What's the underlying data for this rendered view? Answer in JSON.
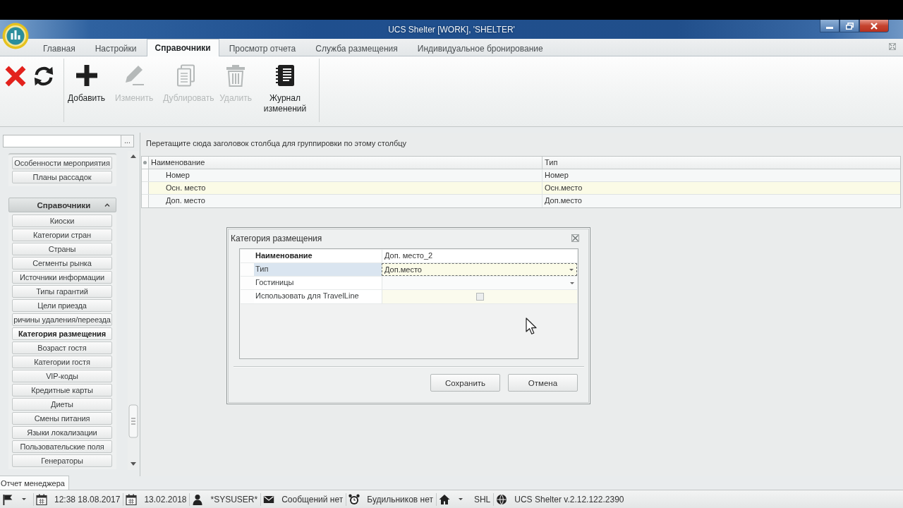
{
  "window": {
    "title": "UCS Shelter [WORK], 'SHELTER'"
  },
  "ribbon_tabs": [
    {
      "label": "Главная",
      "selected": false
    },
    {
      "label": "Настройки",
      "selected": false
    },
    {
      "label": "Справочники",
      "selected": true
    },
    {
      "label": "Просмотр отчета",
      "selected": false
    },
    {
      "label": "Служба размещения",
      "selected": false
    },
    {
      "label": "Индивидуальное бронирование",
      "selected": false
    }
  ],
  "ribbon_groups": [
    {
      "buttons": [
        {
          "kind": "cancel",
          "disabled": false
        },
        {
          "kind": "refresh",
          "disabled": false
        }
      ]
    },
    {
      "buttons": [
        {
          "kind": "add",
          "label": "Добавить",
          "disabled": false
        },
        {
          "kind": "edit",
          "label": "Изменить",
          "disabled": true
        },
        {
          "kind": "duplicate",
          "label": "Дублировать",
          "disabled": true
        },
        {
          "kind": "delete",
          "label": "Удалить",
          "disabled": true
        },
        {
          "kind": "journal",
          "label": "Журнал изменений",
          "disabled": false
        }
      ]
    }
  ],
  "sidebar": {
    "search_button": "...",
    "groups": [
      {
        "items": [
          {
            "label": "Особенности мероприятия",
            "selected": false
          },
          {
            "label": "Планы рассадок",
            "selected": false
          }
        ]
      },
      {
        "title": "Справочники",
        "expanded": true,
        "items": [
          {
            "label": "Киоски",
            "selected": false
          },
          {
            "label": "Категории стран",
            "selected": false
          },
          {
            "label": "Страны",
            "selected": false
          },
          {
            "label": "Сегменты рынка",
            "selected": false
          },
          {
            "label": "Источники информации",
            "selected": false
          },
          {
            "label": "Типы гарантий",
            "selected": false
          },
          {
            "label": "Цели приезда",
            "selected": false
          },
          {
            "label": "ричины удаления/переезда",
            "selected": false
          },
          {
            "label": "Категория размещения",
            "selected": true
          },
          {
            "label": "Возраст гостя",
            "selected": false
          },
          {
            "label": "Категории гостя",
            "selected": false
          },
          {
            "label": "VIP-коды",
            "selected": false
          },
          {
            "label": "Кредитные карты",
            "selected": false
          },
          {
            "label": "Диеты",
            "selected": false
          },
          {
            "label": "Смены питания",
            "selected": false
          },
          {
            "label": "Языки локализации",
            "selected": false
          },
          {
            "label": "Пользовательские поля",
            "selected": false
          },
          {
            "label": "Генераторы",
            "selected": false
          }
        ]
      }
    ]
  },
  "main": {
    "group_panel_hint": "Перетащите сюда заголовок столбца для группировки по этому столбцу",
    "grid": {
      "columns": [
        "Наименование",
        "Тип"
      ],
      "rows": [
        {
          "cells": [
            "Номер",
            "Номер"
          ],
          "selected": false
        },
        {
          "cells": [
            "Осн. место",
            "Осн.место"
          ],
          "selected": true
        },
        {
          "cells": [
            "Доп. место",
            "Доп.место"
          ],
          "selected": false
        }
      ]
    }
  },
  "dialog": {
    "title": "Категория размещения",
    "properties": [
      {
        "kind": "text",
        "label": "Наименование",
        "value": "Доп. место_2",
        "emphasized": true,
        "selected": false
      },
      {
        "kind": "dropdown",
        "label": "Тип",
        "value": "Доп.место",
        "emphasized": false,
        "selected": true
      },
      {
        "kind": "dropdown",
        "label": "Гостиницы",
        "emphasized": false,
        "selected": false
      },
      {
        "kind": "checkbox",
        "label": "Использовать для TravelLine",
        "checked": false,
        "emphasized": false,
        "selected": false
      }
    ],
    "buttons": [
      "Сохранить",
      "Отмена"
    ]
  },
  "bottom_tabs": [
    {
      "label": "Отчет менеджера",
      "selected": true
    }
  ],
  "status_bar": {
    "items": [
      {
        "kind": "flag"
      },
      {
        "kind": "date",
        "text": "12:38 18.08.2017"
      },
      {
        "kind": "date",
        "text": "13.02.2018"
      },
      {
        "kind": "user",
        "text": "*SYSUSER*"
      },
      {
        "kind": "messages",
        "text": "Сообщений нет"
      },
      {
        "kind": "alarms",
        "text": "Будильников нет"
      },
      {
        "kind": "home",
        "text": "SHL"
      },
      {
        "kind": "version",
        "text": "UCS Shelter v.2.12.122.2390"
      }
    ]
  }
}
